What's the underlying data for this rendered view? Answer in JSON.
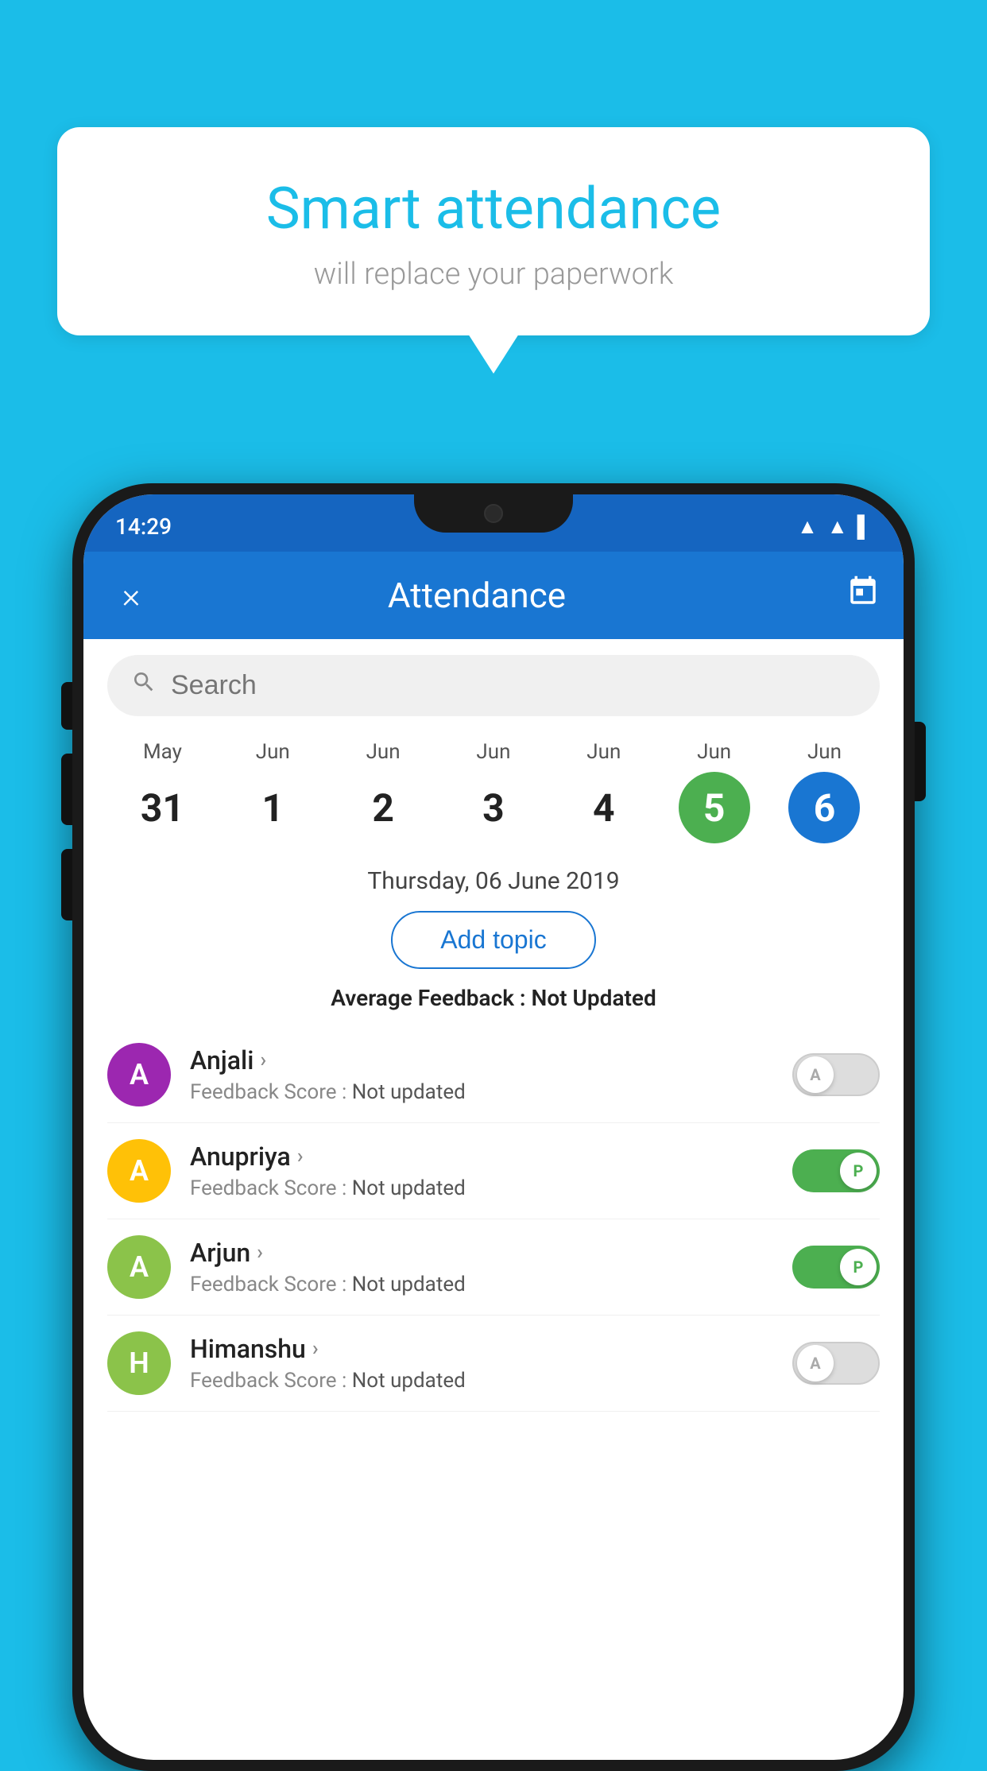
{
  "background": {
    "color": "#1BBDE8"
  },
  "bubble": {
    "title": "Smart attendance",
    "subtitle": "will replace your paperwork"
  },
  "phone": {
    "status_bar": {
      "time": "14:29",
      "icons": [
        "wifi",
        "signal",
        "battery"
      ]
    },
    "app_bar": {
      "title": "Attendance",
      "close_label": "×",
      "calendar_label": "📅"
    },
    "search": {
      "placeholder": "Search"
    },
    "calendar": {
      "days": [
        {
          "month": "May",
          "date": "31",
          "state": "normal"
        },
        {
          "month": "Jun",
          "date": "1",
          "state": "normal"
        },
        {
          "month": "Jun",
          "date": "2",
          "state": "normal"
        },
        {
          "month": "Jun",
          "date": "3",
          "state": "normal"
        },
        {
          "month": "Jun",
          "date": "4",
          "state": "normal"
        },
        {
          "month": "Jun",
          "date": "5",
          "state": "today"
        },
        {
          "month": "Jun",
          "date": "6",
          "state": "selected"
        }
      ]
    },
    "selected_date": "Thursday, 06 June 2019",
    "add_topic_label": "Add topic",
    "avg_feedback_label": "Average Feedback :",
    "avg_feedback_value": "Not Updated",
    "students": [
      {
        "name": "Anjali",
        "avatar_letter": "A",
        "avatar_color": "#9C27B0",
        "feedback_label": "Feedback Score :",
        "feedback_value": "Not updated",
        "attendance": "absent",
        "toggle_letter": "A"
      },
      {
        "name": "Anupriya",
        "avatar_letter": "A",
        "avatar_color": "#FFC107",
        "feedback_label": "Feedback Score :",
        "feedback_value": "Not updated",
        "attendance": "present",
        "toggle_letter": "P"
      },
      {
        "name": "Arjun",
        "avatar_letter": "A",
        "avatar_color": "#8BC34A",
        "feedback_label": "Feedback Score :",
        "feedback_value": "Not updated",
        "attendance": "present",
        "toggle_letter": "P"
      },
      {
        "name": "Himanshu",
        "avatar_letter": "H",
        "avatar_color": "#8BC34A",
        "feedback_label": "Feedback Score :",
        "feedback_value": "Not updated",
        "attendance": "absent",
        "toggle_letter": "A"
      }
    ]
  }
}
